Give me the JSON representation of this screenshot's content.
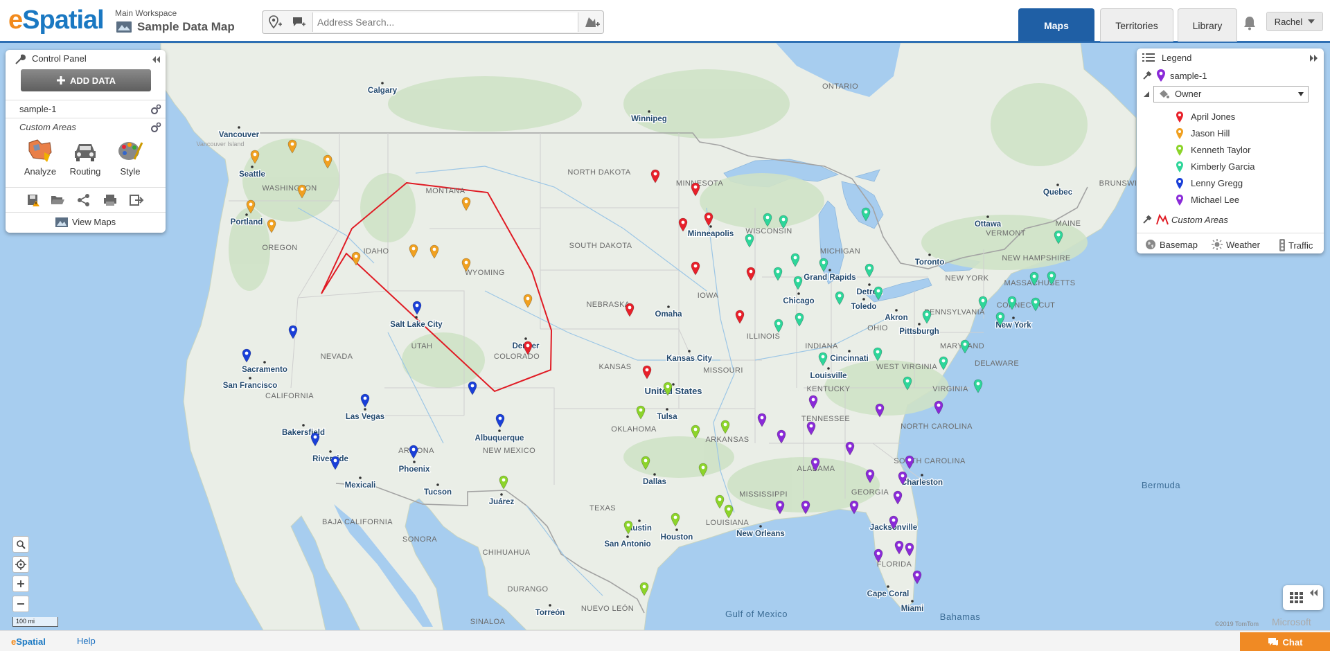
{
  "header": {
    "logo_e": "e",
    "logo_rest": "Spatial",
    "workspace_label": "Main Workspace",
    "map_title": "Sample Data Map",
    "search_placeholder": "Address Search...",
    "tabs": [
      {
        "label": "Maps",
        "active": true
      },
      {
        "label": "Territories",
        "active": false
      },
      {
        "label": "Library",
        "active": false
      }
    ],
    "user_name": "Rachel"
  },
  "control_panel": {
    "title": "Control Panel",
    "add_data_label": "ADD DATA",
    "layer_name": "sample-1",
    "custom_areas_label": "Custom Areas",
    "tools": [
      {
        "label": "Analyze",
        "icon": "analyze-icon"
      },
      {
        "label": "Routing",
        "icon": "car-icon"
      },
      {
        "label": "Style",
        "icon": "palette-icon"
      }
    ],
    "action_icons": [
      "save-icon",
      "open-folder-icon",
      "share-icon",
      "print-icon",
      "export-icon"
    ],
    "view_maps_label": "View Maps"
  },
  "legend": {
    "title": "Legend",
    "layer_name": "sample-1",
    "group_by": "Owner",
    "owners": [
      {
        "name": "April Jones",
        "color": "#e8202a"
      },
      {
        "name": "Jason Hill",
        "color": "#f0a020"
      },
      {
        "name": "Kenneth Taylor",
        "color": "#8cd42a"
      },
      {
        "name": "Kimberly Garcia",
        "color": "#2ed69a"
      },
      {
        "name": "Lenny Gregg",
        "color": "#1a3fd8"
      },
      {
        "name": "Michael Lee",
        "color": "#8a2ad8"
      }
    ],
    "custom_areas_label": "Custom Areas",
    "custom_area_color": "#e01b24",
    "options": [
      "Basemap",
      "Weather",
      "Traffic"
    ]
  },
  "map": {
    "scale_label": "100 mi",
    "copyright": "©2019 TomTom",
    "provider": "Microsoft",
    "region_labels": [
      {
        "text": "ONTARIO",
        "kind": "region"
      },
      {
        "text": "NORTH DAKOTA",
        "kind": "region"
      },
      {
        "text": "MINNESOTA",
        "kind": "region"
      },
      {
        "text": "WASHINGTON",
        "kind": "region"
      },
      {
        "text": "MONTANA",
        "kind": "region"
      },
      {
        "text": "OREGON",
        "kind": "region"
      },
      {
        "text": "IDAHO",
        "kind": "region"
      },
      {
        "text": "WYOMING",
        "kind": "region"
      },
      {
        "text": "SOUTH DAKOTA",
        "kind": "region"
      },
      {
        "text": "WISCONSIN",
        "kind": "region"
      },
      {
        "text": "MICHIGAN",
        "kind": "region"
      },
      {
        "text": "NEBRASKA",
        "kind": "region"
      },
      {
        "text": "IOWA",
        "kind": "region"
      },
      {
        "text": "NEVADA",
        "kind": "region"
      },
      {
        "text": "UTAH",
        "kind": "region"
      },
      {
        "text": "COLORADO",
        "kind": "region"
      },
      {
        "text": "KANSAS",
        "kind": "region"
      },
      {
        "text": "MISSOURI",
        "kind": "region"
      },
      {
        "text": "ILLINOIS",
        "kind": "region"
      },
      {
        "text": "INDIANA",
        "kind": "region"
      },
      {
        "text": "OHIO",
        "kind": "region"
      },
      {
        "text": "PENNSYLVANIA",
        "kind": "region"
      },
      {
        "text": "NEW YORK",
        "kind": "region"
      },
      {
        "text": "CALIFORNIA",
        "kind": "region"
      },
      {
        "text": "KENTUCKY",
        "kind": "region"
      },
      {
        "text": "WEST VIRGINIA",
        "kind": "region"
      },
      {
        "text": "VIRGINIA",
        "kind": "region"
      },
      {
        "text": "MARYLAND",
        "kind": "region"
      },
      {
        "text": "DELAWARE",
        "kind": "region"
      },
      {
        "text": "TENNESSEE",
        "kind": "region"
      },
      {
        "text": "NORTH CAROLINA",
        "kind": "region"
      },
      {
        "text": "OKLAHOMA",
        "kind": "region"
      },
      {
        "text": "ARKANSAS",
        "kind": "region"
      },
      {
        "text": "ARIZONA",
        "kind": "region"
      },
      {
        "text": "NEW MEXICO",
        "kind": "region"
      },
      {
        "text": "SOUTH CAROLINA",
        "kind": "region"
      },
      {
        "text": "ALABAMA",
        "kind": "region"
      },
      {
        "text": "GEORGIA",
        "kind": "region"
      },
      {
        "text": "MISSISSIPPI",
        "kind": "region"
      },
      {
        "text": "TEXAS",
        "kind": "region"
      },
      {
        "text": "LOUISIANA",
        "kind": "region"
      },
      {
        "text": "FLORIDA",
        "kind": "region"
      },
      {
        "text": "BAJA CALIFORNIA",
        "kind": "region"
      },
      {
        "text": "SONORA",
        "kind": "region"
      },
      {
        "text": "CHIHUAHUA",
        "kind": "region"
      },
      {
        "text": "DURANGO",
        "kind": "region"
      },
      {
        "text": "NUEVO LEÓN",
        "kind": "region"
      },
      {
        "text": "SINALOA",
        "kind": "region"
      },
      {
        "text": "VERMONT",
        "kind": "region"
      },
      {
        "text": "MAINE",
        "kind": "region"
      },
      {
        "text": "NEW HAMPSHIRE",
        "kind": "region"
      },
      {
        "text": "MASSACHUSETTS",
        "kind": "region"
      },
      {
        "text": "CONNECTICUT",
        "kind": "region"
      },
      {
        "text": "BRUNSWICK",
        "kind": "region"
      },
      {
        "text": "Vancouver Island",
        "kind": "minor"
      },
      {
        "text": "Gulf of Mexico",
        "kind": "water"
      },
      {
        "text": "Bermuda",
        "kind": "water"
      },
      {
        "text": "Bahamas",
        "kind": "water"
      }
    ],
    "city_labels": [
      "Calgary",
      "Vancouver",
      "Seattle",
      "Portland",
      "Winnipeg",
      "Minneapolis",
      "Salt Lake City",
      "Sacramento",
      "San Francisco",
      "Denver",
      "Omaha",
      "Kansas City",
      "Chicago",
      "Grand Rapids",
      "Detroit",
      "Toledo",
      "Akron",
      "Pittsburgh",
      "Toronto",
      "Ottawa",
      "Quebec",
      "New York",
      "Cincinnati",
      "Louisville",
      "Las Vegas",
      "Bakersfield",
      "Riverside",
      "Mexicali",
      "Phoenix",
      "Tucson",
      "Albuquerque",
      "Juárez",
      "Tulsa",
      "Dallas",
      "Austin",
      "San Antonio",
      "Houston",
      "New Orleans",
      "Jacksonville",
      "Charleston",
      "Cape Coral",
      "Miami",
      "Torreón",
      "United States"
    ]
  }
}
